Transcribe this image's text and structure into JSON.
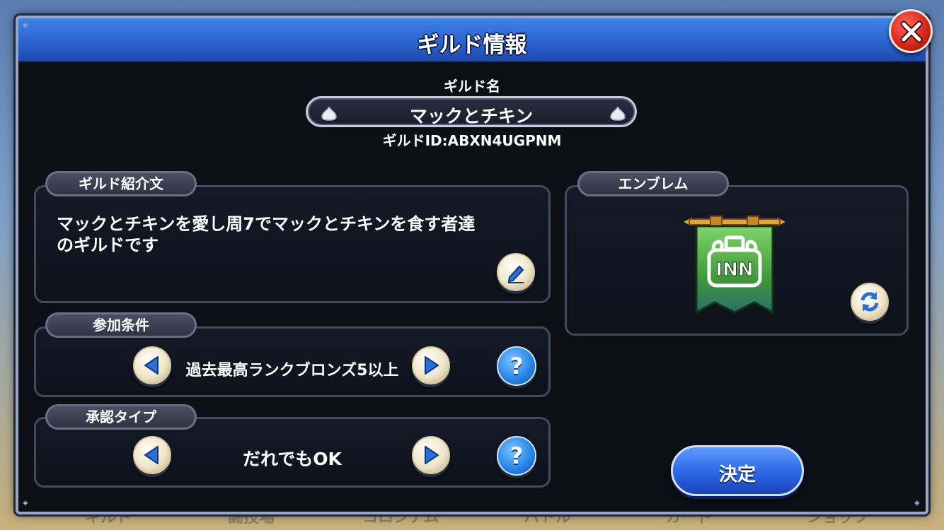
{
  "background_tabs": [
    "ギルド",
    "闘技場",
    "コロシアム",
    "バトル",
    "カード",
    "ショップ"
  ],
  "dialog": {
    "title": "ギルド情報",
    "close_icon": "close-x-icon"
  },
  "guild_name": {
    "label": "ギルド名",
    "value": "マックとチキン",
    "id_text": "ギルドID:ABXN4UGPNM",
    "decor_icon": "slime-icon"
  },
  "introduction": {
    "label": "ギルド紹介文",
    "text": "マックとチキンを愛し周7でマックとチキンを食す者達のギルドです",
    "edit_icon": "pencil-icon"
  },
  "requirement": {
    "label": "参加条件",
    "value": "過去最高ランクブロンズ5以上",
    "help": "?"
  },
  "approval": {
    "label": "承認タイプ",
    "value": "だれでもOK",
    "help": "?"
  },
  "emblem": {
    "label": "エンブレム",
    "banner_text": "INN",
    "refresh_icon": "refresh-icon"
  },
  "confirm_button": "決定",
  "colors": {
    "title_bar": "#2b64d0",
    "dialog_bg": "#0c0f16",
    "panel_border": "#434a5c",
    "confirm": "#2f6ae8",
    "close": "#d8271c",
    "emblem_green": "#3f9a3a"
  }
}
